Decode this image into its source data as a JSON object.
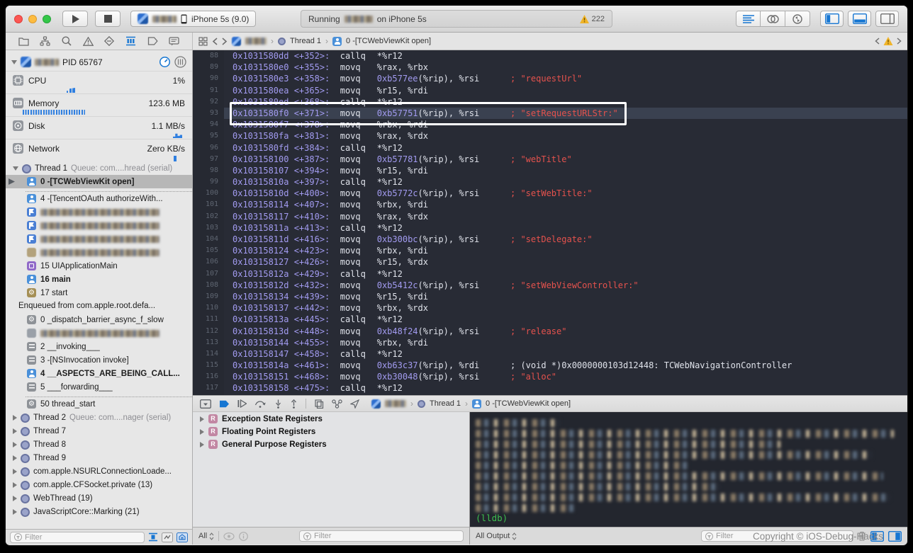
{
  "accent_colors": {
    "xcode_blue": "#1676d2",
    "warning_yellow": "#f0b429",
    "string_red": "#e5524d",
    "address_purple": "#a29bf0",
    "lldb_green": "#3dbd4e"
  },
  "titlebar": {
    "run_icon": "play-icon",
    "stop_icon": "stop-icon",
    "scheme_device": "iPhone 5s (9.0)",
    "status": {
      "prefix": "Running",
      "suffix": "on iPhone 5s",
      "warning_count": "222"
    },
    "editor_modes": [
      "standard-editor-icon",
      "assistant-editor-icon",
      "version-editor-icon"
    ],
    "panels": [
      "navigator-panel-icon",
      "debug-area-panel-icon",
      "utilities-panel-icon"
    ]
  },
  "navigator_bar": {
    "icons": [
      "project-navigator-icon",
      "symbol-navigator-icon",
      "find-navigator-icon",
      "issue-navigator-icon",
      "test-navigator-icon",
      "debug-navigator-icon",
      "breakpoint-navigator-icon",
      "report-navigator-icon"
    ],
    "active_index": 5
  },
  "jump_bar": {
    "thread": "Thread 1",
    "frame": "0 -[TCWebViewKit open]"
  },
  "sidebar": {
    "process": {
      "pid_label": "PID 65767"
    },
    "gauges": [
      {
        "name": "CPU",
        "value": "1%",
        "icon": "cpu-icon"
      },
      {
        "name": "Memory",
        "value": "123.6 MB",
        "icon": "memory-icon"
      },
      {
        "name": "Disk",
        "value": "1.1 MB/s",
        "icon": "disk-icon"
      },
      {
        "name": "Network",
        "value": "Zero KB/s",
        "icon": "network-icon"
      }
    ],
    "thread1": {
      "label": "Thread 1",
      "queue": "Queue: com....hread (serial)"
    },
    "stack": [
      {
        "type": "frame",
        "num": "0",
        "label": "-[TCWebViewKit open]",
        "icon": "user",
        "bold": true,
        "selected": true,
        "pointer": true
      },
      {
        "type": "sep"
      },
      {
        "type": "frame",
        "num": "4",
        "label": "-[TencentOAuth authorizeWith...",
        "icon": "user"
      },
      {
        "type": "frame",
        "blur": true,
        "icon": "flag"
      },
      {
        "type": "frame",
        "blur": true,
        "icon": "flag"
      },
      {
        "type": "frame",
        "blur": true,
        "icon": "flag"
      },
      {
        "type": "frame",
        "blur": true,
        "icon": "tan"
      },
      {
        "type": "frame",
        "num": "15",
        "label": "UIApplicationMain",
        "icon": "uikit"
      },
      {
        "type": "frame",
        "num": "16",
        "label": "main",
        "icon": "user",
        "bold": true
      },
      {
        "type": "frame",
        "num": "17",
        "label": "start",
        "icon": "start"
      },
      {
        "type": "note",
        "label": "Enqueued from com.apple.root.defa..."
      },
      {
        "type": "frame",
        "num": "0",
        "label": "_dispatch_barrier_async_f_slow",
        "icon": "gear"
      },
      {
        "type": "frame",
        "blur": true,
        "icon": "gray"
      },
      {
        "type": "frame",
        "num": "2",
        "label": "__invoking___",
        "icon": "sys"
      },
      {
        "type": "frame",
        "num": "3",
        "label": "-[NSInvocation invoke]",
        "icon": "sys"
      },
      {
        "type": "frame",
        "num": "4",
        "label": "__ASPECTS_ARE_BEING_CALL...",
        "icon": "user",
        "bold": true
      },
      {
        "type": "frame",
        "num": "5",
        "label": "___forwarding___",
        "icon": "sys"
      },
      {
        "type": "sep"
      },
      {
        "type": "frame",
        "num": "50",
        "label": "thread_start",
        "icon": "gear"
      }
    ],
    "threads": [
      {
        "label": "Thread 2",
        "queue": "Queue: com....nager (serial)"
      },
      {
        "label": "Thread 7"
      },
      {
        "label": "Thread 8"
      },
      {
        "label": "Thread 9"
      },
      {
        "label": "com.apple.NSURLConnectionLoade..."
      },
      {
        "label": "com.apple.CFSocket.private (13)"
      },
      {
        "label": "WebThread (19)"
      },
      {
        "label": "JavaScriptCore::Marking (21)"
      }
    ],
    "filter_placeholder": "Filter"
  },
  "editor": {
    "lines": [
      {
        "n": 88,
        "addr": "0x1031580dd",
        "off": "<+352>:",
        "instr": "callq",
        "hex": "",
        "rest": "*%r12",
        "comment": "",
        "ctype": ""
      },
      {
        "n": 89,
        "addr": "0x1031580e0",
        "off": "<+355>:",
        "instr": "movq",
        "hex": "",
        "rest": "%rax, %rbx",
        "comment": "",
        "ctype": ""
      },
      {
        "n": 90,
        "addr": "0x1031580e3",
        "off": "<+358>:",
        "instr": "movq",
        "hex": "0xb577ee",
        "rest": "(%rip), %rsi",
        "comment": "; \"requestUrl\"",
        "ctype": "red"
      },
      {
        "n": 91,
        "addr": "0x1031580ea",
        "off": "<+365>:",
        "instr": "movq",
        "hex": "",
        "rest": "%r15, %rdi",
        "comment": "",
        "ctype": ""
      },
      {
        "n": 92,
        "addr": "0x1031580ed",
        "off": "<+368>:",
        "instr": "callq",
        "hex": "",
        "rest": "*%r12",
        "comment": "",
        "ctype": ""
      },
      {
        "n": 93,
        "addr": "0x1031580f0",
        "off": "<+371>:",
        "instr": "movq",
        "hex": "0xb57751",
        "rest": "(%rip), %rsi",
        "comment": "; \"setRequestURLStr:\"",
        "ctype": "red",
        "selected": true
      },
      {
        "n": 94,
        "addr": "0x1031580f7",
        "off": "<+378>:",
        "instr": "movq",
        "hex": "",
        "rest": "%rbx, %rdi",
        "comment": "",
        "ctype": ""
      },
      {
        "n": 95,
        "addr": "0x1031580fa",
        "off": "<+381>:",
        "instr": "movq",
        "hex": "",
        "rest": "%rax, %rdx",
        "comment": "",
        "ctype": ""
      },
      {
        "n": 96,
        "addr": "0x1031580fd",
        "off": "<+384>:",
        "instr": "callq",
        "hex": "",
        "rest": "*%r12",
        "comment": "",
        "ctype": ""
      },
      {
        "n": 97,
        "addr": "0x103158100",
        "off": "<+387>:",
        "instr": "movq",
        "hex": "0xb57781",
        "rest": "(%rip), %rsi",
        "comment": "; \"webTitle\"",
        "ctype": "red"
      },
      {
        "n": 98,
        "addr": "0x103158107",
        "off": "<+394>:",
        "instr": "movq",
        "hex": "",
        "rest": "%r15, %rdi",
        "comment": "",
        "ctype": ""
      },
      {
        "n": 99,
        "addr": "0x10315810a",
        "off": "<+397>:",
        "instr": "callq",
        "hex": "",
        "rest": "*%r12",
        "comment": "",
        "ctype": ""
      },
      {
        "n": 100,
        "addr": "0x10315810d",
        "off": "<+400>:",
        "instr": "movq",
        "hex": "0xb5772c",
        "rest": "(%rip), %rsi",
        "comment": "; \"setWebTitle:\"",
        "ctype": "red"
      },
      {
        "n": 101,
        "addr": "0x103158114",
        "off": "<+407>:",
        "instr": "movq",
        "hex": "",
        "rest": "%rbx, %rdi",
        "comment": "",
        "ctype": ""
      },
      {
        "n": 102,
        "addr": "0x103158117",
        "off": "<+410>:",
        "instr": "movq",
        "hex": "",
        "rest": "%rax, %rdx",
        "comment": "",
        "ctype": ""
      },
      {
        "n": 103,
        "addr": "0x10315811a",
        "off": "<+413>:",
        "instr": "callq",
        "hex": "",
        "rest": "*%r12",
        "comment": "",
        "ctype": ""
      },
      {
        "n": 104,
        "addr": "0x10315811d",
        "off": "<+416>:",
        "instr": "movq",
        "hex": "0xb300bc",
        "rest": "(%rip), %rsi",
        "comment": "; \"setDelegate:\"",
        "ctype": "red"
      },
      {
        "n": 105,
        "addr": "0x103158124",
        "off": "<+423>:",
        "instr": "movq",
        "hex": "",
        "rest": "%rbx, %rdi",
        "comment": "",
        "ctype": ""
      },
      {
        "n": 106,
        "addr": "0x103158127",
        "off": "<+426>:",
        "instr": "movq",
        "hex": "",
        "rest": "%r15, %rdx",
        "comment": "",
        "ctype": ""
      },
      {
        "n": 107,
        "addr": "0x10315812a",
        "off": "<+429>:",
        "instr": "callq",
        "hex": "",
        "rest": "*%r12",
        "comment": "",
        "ctype": ""
      },
      {
        "n": 108,
        "addr": "0x10315812d",
        "off": "<+432>:",
        "instr": "movq",
        "hex": "0xb5412c",
        "rest": "(%rip), %rsi",
        "comment": "; \"setWebViewController:\"",
        "ctype": "red"
      },
      {
        "n": 109,
        "addr": "0x103158134",
        "off": "<+439>:",
        "instr": "movq",
        "hex": "",
        "rest": "%r15, %rdi",
        "comment": "",
        "ctype": ""
      },
      {
        "n": 110,
        "addr": "0x103158137",
        "off": "<+442>:",
        "instr": "movq",
        "hex": "",
        "rest": "%rbx, %rdx",
        "comment": "",
        "ctype": ""
      },
      {
        "n": 111,
        "addr": "0x10315813a",
        "off": "<+445>:",
        "instr": "callq",
        "hex": "",
        "rest": "*%r12",
        "comment": "",
        "ctype": ""
      },
      {
        "n": 112,
        "addr": "0x10315813d",
        "off": "<+448>:",
        "instr": "movq",
        "hex": "0xb48f24",
        "rest": "(%rip), %rsi",
        "comment": "; \"release\"",
        "ctype": "red"
      },
      {
        "n": 113,
        "addr": "0x103158144",
        "off": "<+455>:",
        "instr": "movq",
        "hex": "",
        "rest": "%rbx, %rdi",
        "comment": "",
        "ctype": ""
      },
      {
        "n": 114,
        "addr": "0x103158147",
        "off": "<+458>:",
        "instr": "callq",
        "hex": "",
        "rest": "*%r12",
        "comment": "",
        "ctype": ""
      },
      {
        "n": 115,
        "addr": "0x10315814a",
        "off": "<+461>:",
        "instr": "movq",
        "hex": "0xb63c37",
        "rest": "(%rip), %rdi",
        "comment": "; (void *)0x0000000103d12448: TCWebNavigationController",
        "ctype": "plain"
      },
      {
        "n": 116,
        "addr": "0x103158151",
        "off": "<+468>:",
        "instr": "movq",
        "hex": "0xb30048",
        "rest": "(%rip), %rsi",
        "comment": "; \"alloc\"",
        "ctype": "red"
      },
      {
        "n": 117,
        "addr": "0x103158158",
        "off": "<+475>:",
        "instr": "callq",
        "hex": "",
        "rest": "*%r12",
        "comment": "",
        "ctype": ""
      }
    ]
  },
  "debug_bar": {
    "icons": [
      "hide-debug-area-icon",
      "breakpoints-toggle-icon",
      "continue-icon",
      "step-over-icon",
      "step-into-icon",
      "step-out-icon",
      "view-hierarchy-icon",
      "memory-graph-icon",
      "simulate-location-icon"
    ],
    "thread": "Thread 1",
    "frame": "0 -[TCWebViewKit open]"
  },
  "variables_view": {
    "groups": [
      "Exception State Registers",
      "Floating Point Registers",
      "General Purpose Registers"
    ],
    "scope_label": "All",
    "filter_placeholder": "Filter"
  },
  "console": {
    "prompt": "(lldb)",
    "scope_label": "All Output",
    "filter_placeholder": "Filter",
    "watermark": "Copyright © iOS-Debug-Hacks"
  }
}
